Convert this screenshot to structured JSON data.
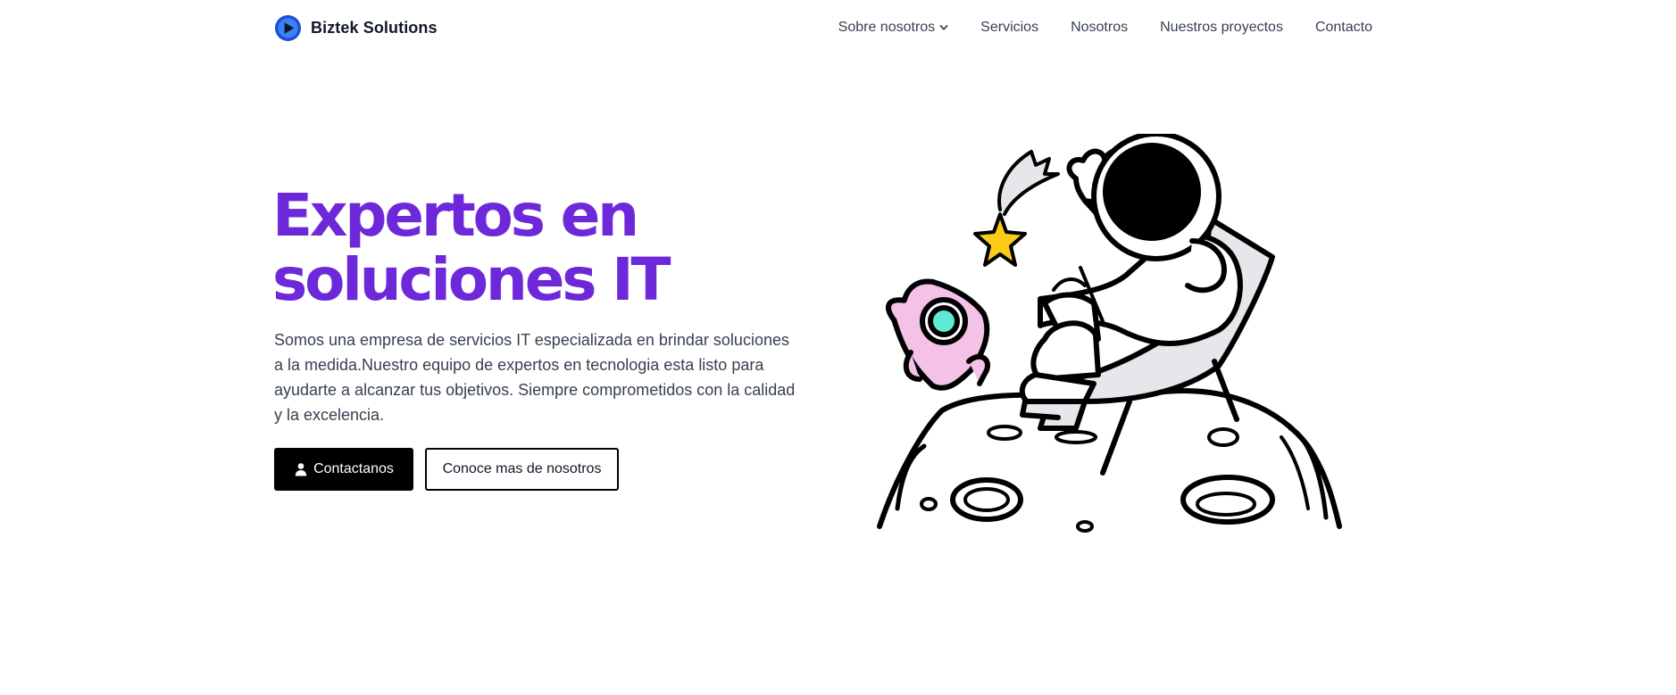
{
  "brand": {
    "name": "Biztek Solutions",
    "logo_icon": "play-circle-icon",
    "logo_color": "#2563eb"
  },
  "nav": {
    "items": [
      {
        "label": "Sobre nosotros",
        "has_dropdown": true
      },
      {
        "label": "Servicios"
      },
      {
        "label": "Nosotros"
      },
      {
        "label": "Nuestros proyectos"
      },
      {
        "label": "Contacto"
      }
    ]
  },
  "hero": {
    "title_line1": "Expertos en",
    "title_line2": "soluciones IT",
    "title_color": "#6d28d9",
    "description": "Somos una empresa de servicios IT especializada en brindar soluciones a la medida.Nuestro equipo de expertos en tecnologia esta listo para ayudarte a alcanzar tus objetivos. Siempre comprometidos con la calidad y la excelencia.",
    "primary_button": {
      "label": "Contactanos",
      "icon": "user-icon"
    },
    "secondary_button": {
      "label": "Conoce mas de nosotros"
    }
  },
  "illustration": {
    "subject": "astronaut-on-moon-illustration",
    "accent_colors": {
      "rocket": "#f5c2e7",
      "window": "#5eead4",
      "star": "#facc15",
      "chair": "#e5e7eb"
    }
  }
}
